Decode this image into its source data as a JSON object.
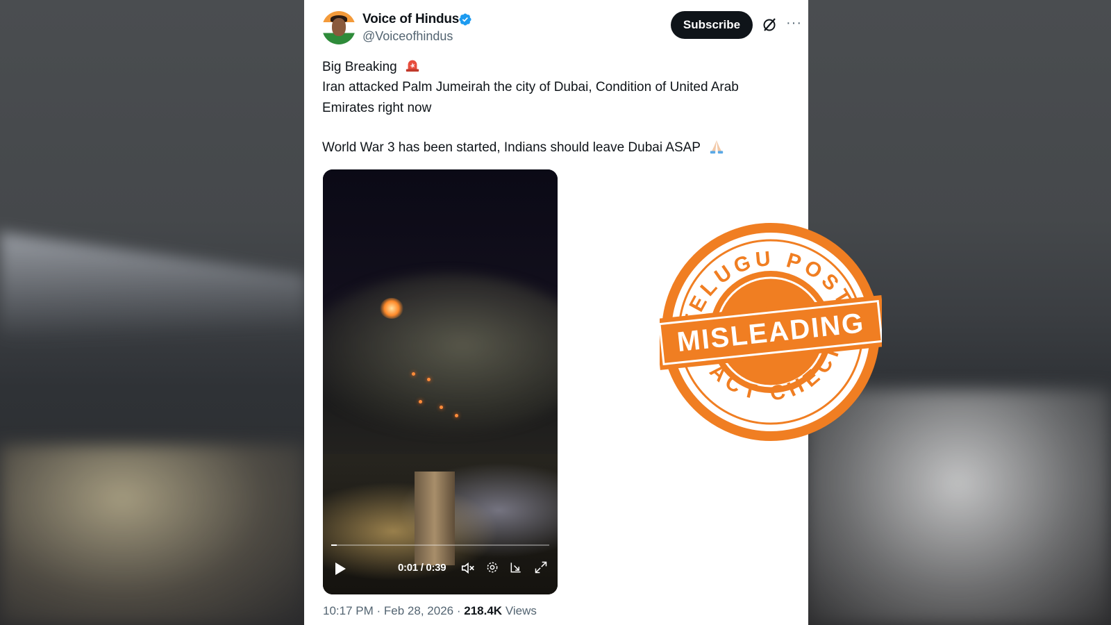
{
  "tweet": {
    "display_name": "Voice of Hindus",
    "handle": "@Voiceofhindus",
    "subscribe_label": "Subscribe",
    "more_label": "···",
    "line1": "Big Breaking",
    "line2": "Iran attacked Palm Jumeirah the city of Dubai, Condition of United Arab Emirates right now",
    "line3": "World War 3 has been started, Indians should leave Dubai ASAP",
    "icons": {
      "verified": "verified-badge-icon",
      "grok": "grok-icon",
      "siren": "siren-emoji",
      "pray": "folded-hands-emoji"
    }
  },
  "video": {
    "time": "0:01 / 0:39",
    "progress": 0.026
  },
  "meta": {
    "time": "10:17 PM",
    "sep": "·",
    "date": "Feb 28, 2026",
    "views_count": "218.4K",
    "views_label": "Views"
  },
  "stamp": {
    "top_text": "TELUGU POST",
    "middle_text": "MISLEADING",
    "bottom_text": "FACT CHECK",
    "color": "#f07e22"
  }
}
